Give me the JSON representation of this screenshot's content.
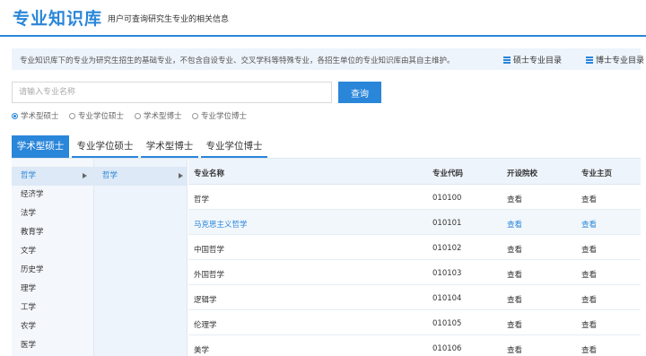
{
  "header": {
    "title": "专业知识库",
    "subtitle": "用户可查询研究生专业的相关信息"
  },
  "notice": {
    "text": "专业知识库下的专业为研究生招生的基础专业，不包含自设专业、交叉学科等特殊专业，各招生单位的专业知识库由其自主维护。",
    "master_catalog": "硕士专业目录",
    "doctor_catalog": "博士专业目录"
  },
  "search": {
    "placeholder": "请输入专业名称",
    "button": "查询"
  },
  "radios": [
    {
      "label": "学术型硕士",
      "checked": true
    },
    {
      "label": "专业学位硕士",
      "checked": false
    },
    {
      "label": "学术型博士",
      "checked": false
    },
    {
      "label": "专业学位博士",
      "checked": false
    }
  ],
  "tabs": [
    {
      "label": "学术型硕士",
      "active": true
    },
    {
      "label": "专业学位硕士",
      "active": false
    },
    {
      "label": "学术型博士",
      "active": false
    },
    {
      "label": "专业学位博士",
      "active": false
    }
  ],
  "categories": [
    "哲学",
    "经济学",
    "法学",
    "教育学",
    "文学",
    "历史学",
    "理学",
    "工学",
    "农学",
    "医学"
  ],
  "subcategory": "哲学",
  "table": {
    "headers": {
      "name": "专业名称",
      "code": "专业代码",
      "school": "开设院校",
      "home": "专业主页"
    },
    "rows": [
      {
        "name": "哲学",
        "code": "010100",
        "school": "查看",
        "home": "查看"
      },
      {
        "name": "马克思主义哲学",
        "code": "010101",
        "school": "查看",
        "home": "查看"
      },
      {
        "name": "中国哲学",
        "code": "010102",
        "school": "查看",
        "home": "查看"
      },
      {
        "name": "外国哲学",
        "code": "010103",
        "school": "查看",
        "home": "查看"
      },
      {
        "name": "逻辑学",
        "code": "010104",
        "school": "查看",
        "home": "查看"
      },
      {
        "name": "伦理学",
        "code": "010105",
        "school": "查看",
        "home": "查看"
      },
      {
        "name": "美学",
        "code": "010106",
        "school": "查看",
        "home": "查看"
      }
    ]
  },
  "colors": {
    "accent": "#2a86d9",
    "panel_bg": "#eef4fb"
  }
}
